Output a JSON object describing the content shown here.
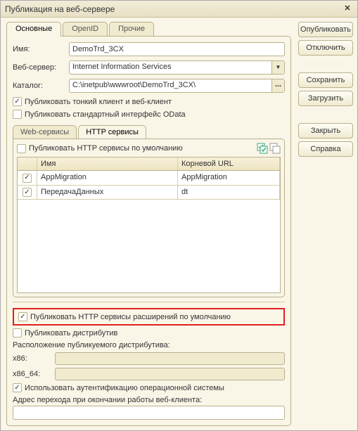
{
  "title": "Публикация на веб-сервере",
  "buttons": {
    "publish": "Опубликовать",
    "disable": "Отключить",
    "save": "Сохранить",
    "load": "Загрузить",
    "close": "Закрыть",
    "help": "Справка"
  },
  "tabs": {
    "main": "Основные",
    "openid": "OpenID",
    "other": "Прочие"
  },
  "labels": {
    "name": "Имя:",
    "webserver": "Веб-сервер:",
    "catalog": "Каталог:"
  },
  "values": {
    "name": "DemoTrd_3CX",
    "webserver": "Internet Information Services",
    "catalog": "C:\\inetpub\\wwwroot\\DemoTrd_3CX\\"
  },
  "checks": {
    "thin_client": "Публиковать тонкий клиент и веб-клиент",
    "odata": "Публиковать стандартный интерфейс OData",
    "http_default": "Публиковать HTTP сервисы по умолчанию",
    "http_ext_default": "Публиковать HTTP сервисы расширений по умолчанию",
    "distrib": "Публиковать дистрибутив",
    "os_auth": "Использовать аутентификацию операционной системы"
  },
  "sub_tabs": {
    "ws": "Web-сервисы",
    "http": "HTTP сервисы"
  },
  "table": {
    "headers": {
      "name": "Имя",
      "root": "Корневой URL"
    },
    "rows": [
      {
        "checked": true,
        "name": "AppMigration",
        "root": "AppMigration"
      },
      {
        "checked": true,
        "name": "ПередачаДанных",
        "root": "dt"
      }
    ]
  },
  "dist": {
    "location_label": "Расположение публикуемого дистрибутива:",
    "x86": "x86:",
    "x86_64": "x86_64:"
  },
  "addr_label": "Адрес перехода при окончании работы веб-клиента:"
}
